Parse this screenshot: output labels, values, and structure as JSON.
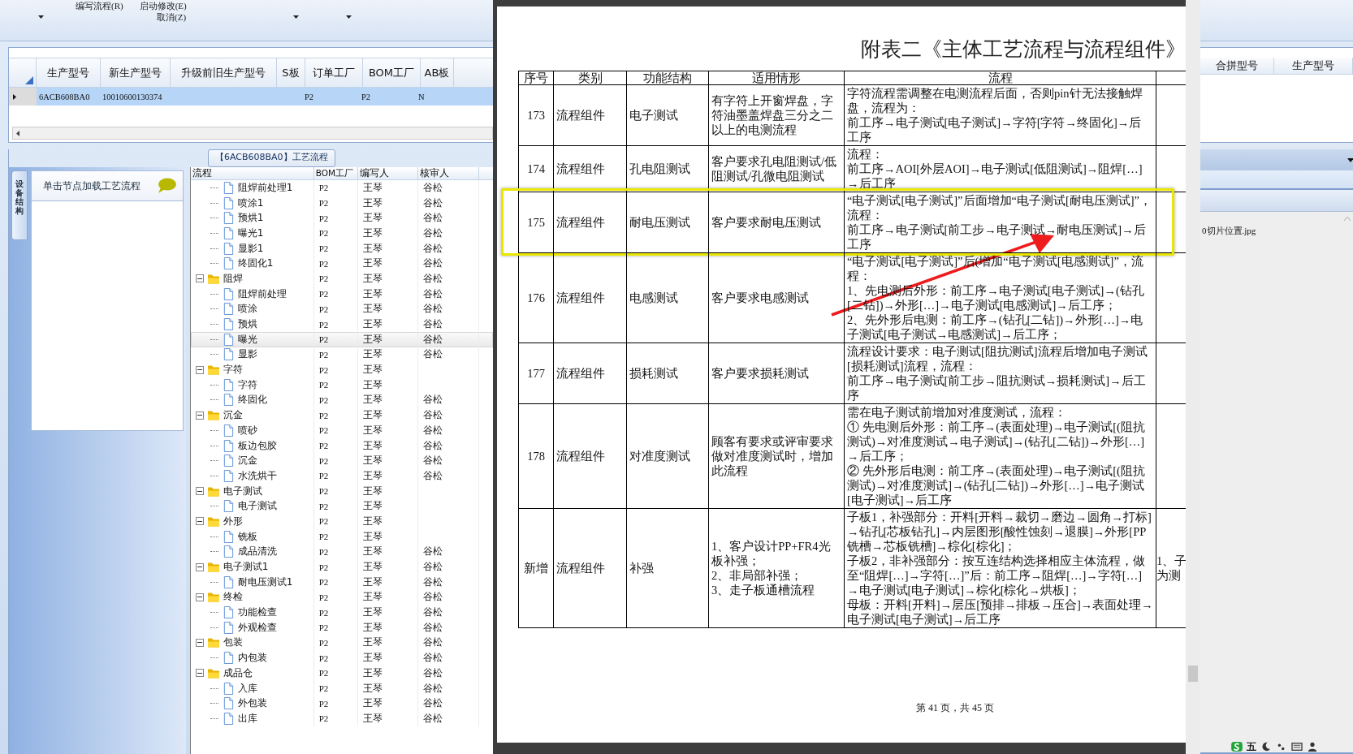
{
  "ribbon": {
    "buttons": [
      "编写流程(R)",
      "启动修改(E)",
      "取消(Z)"
    ]
  },
  "model_grid": {
    "columns": [
      "生产型号",
      "新生产型号",
      "升级前旧生产型号",
      "S板",
      "订单工厂",
      "BOM工厂",
      "AB板"
    ],
    "rows": [
      {
        "selected": true,
        "cells": [
          "6ACB608BA0",
          "10010600130374",
          "",
          "",
          "P2",
          "P2",
          "N"
        ]
      }
    ]
  },
  "flow_panel": {
    "title": "【6ACB608BA0】工艺流程",
    "side_tab": "设备结构",
    "side_hint": "单击节点加载工艺流程"
  },
  "tree": {
    "columns": [
      "流程",
      "BOM工厂",
      "编写人",
      "核审人"
    ],
    "nodes": [
      {
        "kind": "continued",
        "children": [
          {
            "kind": "file",
            "name": "阻焊前处理1",
            "bom": "P2",
            "writer": "王琴",
            "reviewer": "谷松",
            "selected": false
          },
          {
            "kind": "file",
            "name": "喷涂1",
            "bom": "P2",
            "writer": "王琴",
            "reviewer": "谷松",
            "selected": false
          },
          {
            "kind": "file",
            "name": "预烘1",
            "bom": "P2",
            "writer": "王琴",
            "reviewer": "谷松",
            "selected": false
          },
          {
            "kind": "file",
            "name": "曝光1",
            "bom": "P2",
            "writer": "王琴",
            "reviewer": "谷松",
            "selected": false
          },
          {
            "kind": "file",
            "name": "显影1",
            "bom": "P2",
            "writer": "王琴",
            "reviewer": "谷松",
            "selected": false
          },
          {
            "kind": "file",
            "name": "终固化1",
            "bom": "P2",
            "writer": "王琴",
            "reviewer": "谷松",
            "selected": false
          }
        ]
      },
      {
        "kind": "folder",
        "name": "阻焊",
        "bom": "P2",
        "writer": "王琴",
        "reviewer": "谷松",
        "selected": false,
        "expanded": true,
        "children": [
          {
            "kind": "file",
            "name": "阻焊前处理",
            "bom": "P2",
            "writer": "王琴",
            "reviewer": "谷松",
            "selected": false
          },
          {
            "kind": "file",
            "name": "喷涂",
            "bom": "P2",
            "writer": "王琴",
            "reviewer": "谷松",
            "selected": false
          },
          {
            "kind": "file",
            "name": "预烘",
            "bom": "P2",
            "writer": "王琴",
            "reviewer": "谷松",
            "selected": false
          },
          {
            "kind": "file",
            "name": "曝光",
            "bom": "P2",
            "writer": "王琴",
            "reviewer": "谷松",
            "selected": true
          },
          {
            "kind": "file",
            "name": "显影",
            "bom": "P2",
            "writer": "王琴",
            "reviewer": "谷松",
            "selected": false
          }
        ]
      },
      {
        "kind": "folder",
        "name": "字符",
        "bom": "P2",
        "writer": "王琴",
        "selected": false,
        "expanded": true,
        "children": [
          {
            "kind": "file",
            "name": "字符",
            "bom": "P2",
            "writer": "王琴",
            "selected": false
          },
          {
            "kind": "file",
            "name": "终固化",
            "bom": "P2",
            "writer": "王琴",
            "reviewer": "谷松",
            "selected": false
          }
        ]
      },
      {
        "kind": "folder",
        "name": "沉金",
        "bom": "P2",
        "writer": "王琴",
        "reviewer": "谷松",
        "selected": false,
        "expanded": true,
        "children": [
          {
            "kind": "file",
            "name": "喷砂",
            "bom": "P2",
            "writer": "王琴",
            "reviewer": "谷松",
            "selected": false
          },
          {
            "kind": "file",
            "name": "板边包胶",
            "bom": "P2",
            "writer": "王琴",
            "reviewer": "谷松",
            "selected": false
          },
          {
            "kind": "file",
            "name": "沉金",
            "bom": "P2",
            "writer": "王琴",
            "reviewer": "谷松",
            "selected": false
          },
          {
            "kind": "file",
            "name": "水洗烘干",
            "bom": "P2",
            "writer": "王琴",
            "reviewer": "谷松",
            "selected": false
          }
        ]
      },
      {
        "kind": "folder",
        "name": "电子测试",
        "bom": "P2",
        "writer": "王琴",
        "selected": false,
        "expanded": true,
        "children": [
          {
            "kind": "file",
            "name": "电子测试",
            "bom": "P2",
            "writer": "王琴",
            "selected": false
          }
        ]
      },
      {
        "kind": "folder",
        "name": "外形",
        "bom": "P2",
        "writer": "王琴",
        "selected": false,
        "expanded": true,
        "children": [
          {
            "kind": "file",
            "name": "铣板",
            "bom": "P2",
            "writer": "王琴",
            "selected": false
          },
          {
            "kind": "file",
            "name": "成品清洗",
            "bom": "P2",
            "writer": "王琴",
            "reviewer": "谷松",
            "selected": false
          }
        ]
      },
      {
        "kind": "folder",
        "name": "电子测试1",
        "bom": "P2",
        "writer": "王琴",
        "reviewer": "谷松",
        "selected": false,
        "expanded": true,
        "children": [
          {
            "kind": "file",
            "name": "耐电压测试1",
            "bom": "P2",
            "writer": "王琴",
            "reviewer": "谷松",
            "selected": false
          }
        ]
      },
      {
        "kind": "folder",
        "name": "终检",
        "bom": "P2",
        "writer": "王琴",
        "reviewer": "谷松",
        "selected": false,
        "expanded": true,
        "children": [
          {
            "kind": "file",
            "name": "功能检查",
            "bom": "P2",
            "writer": "王琴",
            "reviewer": "谷松",
            "selected": false
          },
          {
            "kind": "file",
            "name": "外观检查",
            "bom": "P2",
            "writer": "王琴",
            "reviewer": "谷松",
            "selected": false
          }
        ]
      },
      {
        "kind": "folder",
        "name": "包装",
        "bom": "P2",
        "writer": "王琴",
        "reviewer": "谷松",
        "selected": false,
        "expanded": true,
        "children": [
          {
            "kind": "file",
            "name": "内包装",
            "bom": "P2",
            "writer": "王琴",
            "reviewer": "谷松",
            "selected": false
          }
        ]
      },
      {
        "kind": "folder",
        "name": "成品仓",
        "bom": "P2",
        "writer": "王琴",
        "reviewer": "谷松",
        "selected": false,
        "expanded": true,
        "children": [
          {
            "kind": "file",
            "name": "入库",
            "bom": "P2",
            "writer": "王琴",
            "reviewer": "谷松",
            "selected": false
          },
          {
            "kind": "file",
            "name": "外包装",
            "bom": "P2",
            "writer": "王琴",
            "reviewer": "谷松",
            "selected": false
          },
          {
            "kind": "file",
            "name": "出库",
            "bom": "P2",
            "writer": "王琴",
            "reviewer": "谷松",
            "selected": false
          }
        ]
      }
    ]
  },
  "document": {
    "title": "附表二《主体工艺流程与流程组件》",
    "columns": [
      "序号",
      "类别",
      "功能结构",
      "适用情形",
      "流程"
    ],
    "rows": [
      {
        "no": "173",
        "category": "流程组件",
        "function": "电子测试",
        "condition": [
          "有字符上开窗焊盘，字符油墨盖焊盘三分之二以上的电测流程"
        ],
        "flow": [
          "字符流程需调整在电测流程后面，否则pin针无法接触焊盘，流程为：",
          "前工序→电子测试[电子测试]→字符[字符→终固化]→后工序"
        ],
        "highlighted": false
      },
      {
        "no": "174",
        "category": "流程组件",
        "function": "孔电阻测试",
        "condition": [
          "客户要求孔电阻测试/低阻测试/孔微电阻测试"
        ],
        "flow": [
          "流程：",
          "前工序→AOI[外层AOI]→电子测试[低阻测试]→阻焊[…]→后工序"
        ],
        "highlighted": false
      },
      {
        "no": "175",
        "category": "流程组件",
        "function": "耐电压测试",
        "condition": [
          "客户要求耐电压测试"
        ],
        "flow": [
          "“电子测试[电子测试]”后面增加“电子测试[耐电压测试]”，流程：",
          "前工序→电子测试[前工步→电子测试→耐电压测试]→后工序"
        ],
        "highlighted": true
      },
      {
        "no": "176",
        "category": "流程组件",
        "function": "电感测试",
        "condition": [
          "客户要求电感测试"
        ],
        "flow": [
          "“电子测试[电子测试]”后(增加“电子测试[电感测试]”，流程：",
          "1、先电测后外形：前工序→电子测试[电子测试]→(钻孔[二钻])→外形[…]→电子测试[电感测试]→后工序；",
          "2、先外形后电测：前工序→(钻孔[二钻])→外形[…]→电子测试[电子测试→电感测试]→后工序；"
        ],
        "highlighted": false
      },
      {
        "no": "177",
        "category": "流程组件",
        "function": "损耗测试",
        "condition": [
          "客户要求损耗测试"
        ],
        "flow": [
          "流程设计要求：电子测试[阻抗测试]流程后增加电子测试[损耗测试]流程，流程：",
          "前工序→电子测试[前工步→阻抗测试→损耗测试]→后工序"
        ],
        "highlighted": false
      },
      {
        "no": "178",
        "category": "流程组件",
        "function": "对准度测试",
        "condition": [
          "顾客有要求或评审要求做对准度测试时，增加此流程"
        ],
        "flow": [
          "需在电子测试前增加对准度测试，流程：",
          "① 先电测后外形：前工序→(表面处理)→电子测试[(阻抗测试)→对准度测试→电子测试]→(钻孔[二钻])→外形[…]→后工序；",
          "② 先外形后电测：前工序→(表面处理)→电子测试[(阻抗测试)→对准度测试]→(钻孔[二钻])→外形[…]→电子测试[电子测试]→后工序"
        ],
        "highlighted": false
      },
      {
        "no": "新增",
        "category": "流程组件",
        "function": "补强",
        "condition": [
          "1、客户设计PP+FR4光板补强；",
          "2、非局部补强；",
          "3、走子板通槽流程"
        ],
        "flow": [
          "子板1，补强部分：开料[开料→裁切→磨边→圆角→打标]→钻孔[芯板钻孔]→内层图形[酸性蚀刻→退膜]→外形[PP铣槽→芯板铣槽]→棕化[棕化]；",
          "子板2，非补强部分：按互连结构选择相应主体流程，做至“阻焊[…]→字符[…]”后：前工序→阻焊[…]→字符[…]→电子测试[电子测试]→棕化[棕化→烘板]；",
          "母板：开料[开料]→层压[预排→排板→压合]→表面处理→电子测试[电子测试]→后工序"
        ],
        "column_6": [
          "1、子",
          "为测"
        ],
        "highlighted": false
      }
    ],
    "footer": "第 41 页，共 45 页"
  },
  "right_grid": {
    "columns": [
      "合拼型号",
      "生产型号"
    ]
  },
  "attachments": [
    "0切片位置.jpg"
  ],
  "ime_bar": {
    "mode": "五"
  }
}
